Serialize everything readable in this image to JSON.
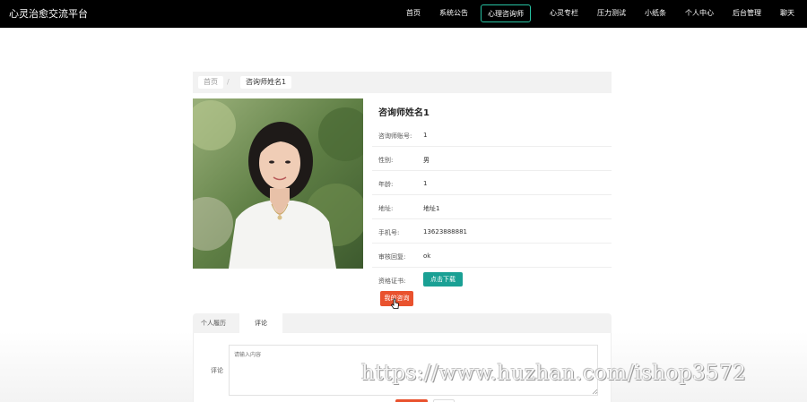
{
  "brand": "心灵治愈交流平台",
  "nav": [
    {
      "label": "首页",
      "active": false
    },
    {
      "label": "系统公告",
      "active": false
    },
    {
      "label": "心理咨询师",
      "active": true
    },
    {
      "label": "心灵专栏",
      "active": false
    },
    {
      "label": "压力测试",
      "active": false
    },
    {
      "label": "小纸条",
      "active": false
    },
    {
      "label": "个人中心",
      "active": false
    },
    {
      "label": "后台管理",
      "active": false
    },
    {
      "label": "聊天",
      "active": false
    }
  ],
  "breadcrumb": {
    "home": "首页",
    "separator": "/",
    "current": "咨询师姓名1"
  },
  "counselor": {
    "name": "咨询师姓名1",
    "fields": [
      {
        "label": "咨询师账号:",
        "value": "1"
      },
      {
        "label": "性别:",
        "value": "男"
      },
      {
        "label": "年龄:",
        "value": "1"
      },
      {
        "label": "地址:",
        "value": "地址1"
      },
      {
        "label": "手机号:",
        "value": "13623888881"
      },
      {
        "label": "审核回复:",
        "value": "ok"
      }
    ],
    "certificate_label": "资格证书:",
    "download_label": "点击下载",
    "select_label": "我的咨询"
  },
  "tabs": [
    {
      "label": "个人履历",
      "active": false
    },
    {
      "label": "评论",
      "active": true
    }
  ],
  "comment": {
    "label": "评论",
    "placeholder": "请输入内容"
  },
  "watermark": "https://www.huzhan.com/ishop3572",
  "colors": {
    "accent": "#1aa094",
    "nav_active_border": "#27c2a2",
    "primary_button": "#e9522e",
    "topbar": "#000000"
  }
}
